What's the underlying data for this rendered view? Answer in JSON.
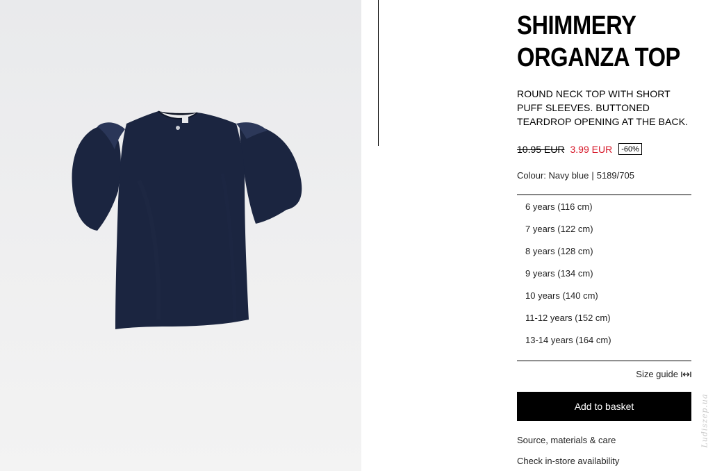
{
  "product": {
    "title_line1": "SHIMMERY",
    "title_line2": "ORGANZA TOP",
    "description": "ROUND NECK TOP WITH SHORT PUFF SLEEVES. BUTTONED TEARDROP OPENING AT THE BACK.",
    "old_price": "10.95 EUR",
    "new_price": "3.99 EUR",
    "discount": "-60%",
    "colour_label": "Colour: Navy blue",
    "colour_separator": "|",
    "reference": "5189/705",
    "garment_color": "#1b2540",
    "price_red": "#d7192a"
  },
  "sizes": [
    "6 years (116 cm)",
    "7 years (122 cm)",
    "8 years (128 cm)",
    "9 years (134 cm)",
    "10 years (140 cm)",
    "11-12 years (152 cm)",
    "13-14 years (164 cm)"
  ],
  "size_guide": {
    "label": "Size guide",
    "icon": "ruler-arrows-icon"
  },
  "actions": {
    "add_to_basket": "Add to basket",
    "source_materials": "Source, materials & care",
    "store_availability": "Check in-store availability"
  },
  "watermark": "Ludiszep.ua"
}
